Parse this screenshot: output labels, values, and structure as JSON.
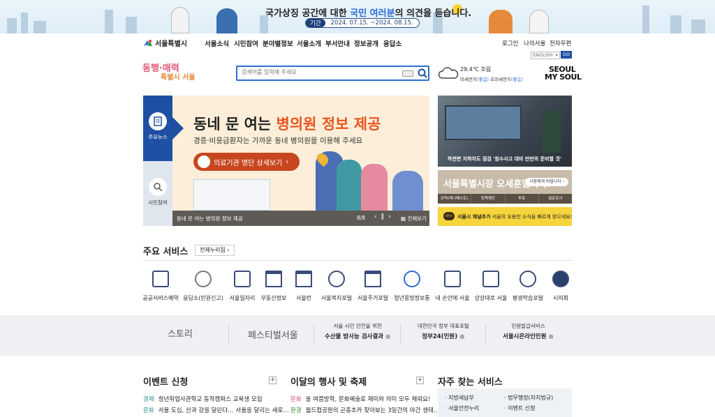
{
  "top_banner": {
    "title_prefix": "국가상징 공간에 대한",
    "title_highlight": "국민 여러분",
    "title_suffix": "의 의견을 듣습니다.",
    "period_label": "기간",
    "period_value": "2024. 07.15. ~2024. 08.15."
  },
  "header": {
    "logo": "서울특별시",
    "gnb": [
      "서울소식",
      "시민참여",
      "분야별정보",
      "서울소개",
      "부서안내",
      "정보공개",
      "응답소"
    ],
    "util": [
      "로그인",
      "나의서울",
      "전자우편"
    ],
    "lang": "ENGLISH",
    "go": "GO",
    "slogan_1": "동행·매력",
    "slogan_2": "특별시 서울",
    "search_placeholder": "검색어를 입력해 주세요",
    "weather_temp": "29.4℃ 흐림",
    "dust_label_1": "미세먼지",
    "dust_value_1": "(좋음)",
    "dust_label_2": "초미세먼지",
    "dust_value_2": "(좋음)",
    "brand_1": "SEOUL",
    "brand_2": "MY SOUL"
  },
  "slide": {
    "tab_news": "주요뉴스",
    "tab_citizen": "시민참여",
    "title_prefix": "동네 문 여는",
    "title_highlight": "병의원 정보 제공",
    "subtitle": "경증·비응급환자는 가까운 동네 병의원을 이용해 주세요",
    "button": "의료기관 명단 상세보기",
    "caption": "동네 문 여는 병의원 정보 제공",
    "page": "8/8",
    "view_all": "전체보기"
  },
  "right": {
    "news_caption": "하천변 지하차도 점검 '침수사고 대비 만반의 준비할 것'",
    "mayor_text": "서울특별시장 오세훈입니다.",
    "mayor_button": "시장에게 바랍니다",
    "mayor_menu": [
      "공약(매니페스토)",
      "정책제안",
      "투표",
      "설문조사"
    ],
    "channel_add": "서울시 채널추가",
    "channel_desc": "서울의 유용한 소식을 빠르게 받으세요!"
  },
  "services": {
    "title": "주요 서비스",
    "all_button": "전체누리집",
    "items": [
      "공공서비스예약",
      "응답소(민원신고)",
      "서울일자리",
      "부동산정보",
      "서울런",
      "서울복지포털",
      "서울주거포털",
      "청년몽땅정보통",
      "내 손안에 서울",
      "상상대로 서울",
      "평생학습포털",
      "시의회"
    ]
  },
  "band": {
    "story": "스토리",
    "festival": "페스티벌서울",
    "item3_sub": "서울 시민 안전을 위한",
    "item3_title": "수산물 방사능 검사결과",
    "item4_sub": "대한민국 정부 대표포털",
    "item4_title": "정부24(민원)",
    "item5_sub": "민원발급서비스",
    "item5_title": "서울시온라인민원"
  },
  "events": {
    "title": "이벤트 신청",
    "items": [
      {
        "cat": "경제",
        "text": "청년취업사관학교 동작캠퍼스 교육생 모집"
      },
      {
        "cat": "문화",
        "text": "서울 도심, 산과 강을 달린다… 서울을 달리는 새로…"
      }
    ]
  },
  "festivals": {
    "title": "이달의 행사 및 축제",
    "items": [
      {
        "cat": "문화",
        "text": "올 여름방학, 문화예술로 재미와 의미 모두 채워요!"
      },
      {
        "cat": "환경",
        "text": "월드컵공원의 곤충초카 찾아보는 3일간의 야간 생태…"
      }
    ]
  },
  "frequent": {
    "title": "자주 찾는 서비스",
    "items": [
      "지방세납부",
      "법무행정(자치법규)",
      "서울안전누리",
      "이벤트 신청"
    ]
  }
}
